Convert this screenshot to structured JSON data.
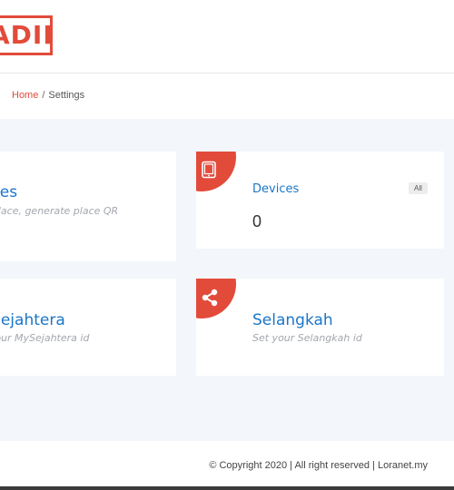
{
  "brand": {
    "logo_text": "ADIR",
    "accent": "#e24b3a",
    "link": "#1a76c8"
  },
  "breadcrumb": {
    "home": "Home",
    "separator": "/",
    "current": "Settings"
  },
  "cards": {
    "places": {
      "title": "aces",
      "subtitle": "it place, generate place QR\nde"
    },
    "devices": {
      "title": "Devices",
      "tag": "All",
      "value": "0",
      "icon": "tablet-icon"
    },
    "mysejahtera": {
      "title": "ySejahtera",
      "subtitle": "t your MySejahtera id"
    },
    "selangkah": {
      "title": "Selangkah",
      "subtitle": "Set your Selangkah id",
      "icon": "share-icon"
    }
  },
  "footer": {
    "copyright": "© Copyright 2020 | All right reserved | Loranet.my"
  }
}
